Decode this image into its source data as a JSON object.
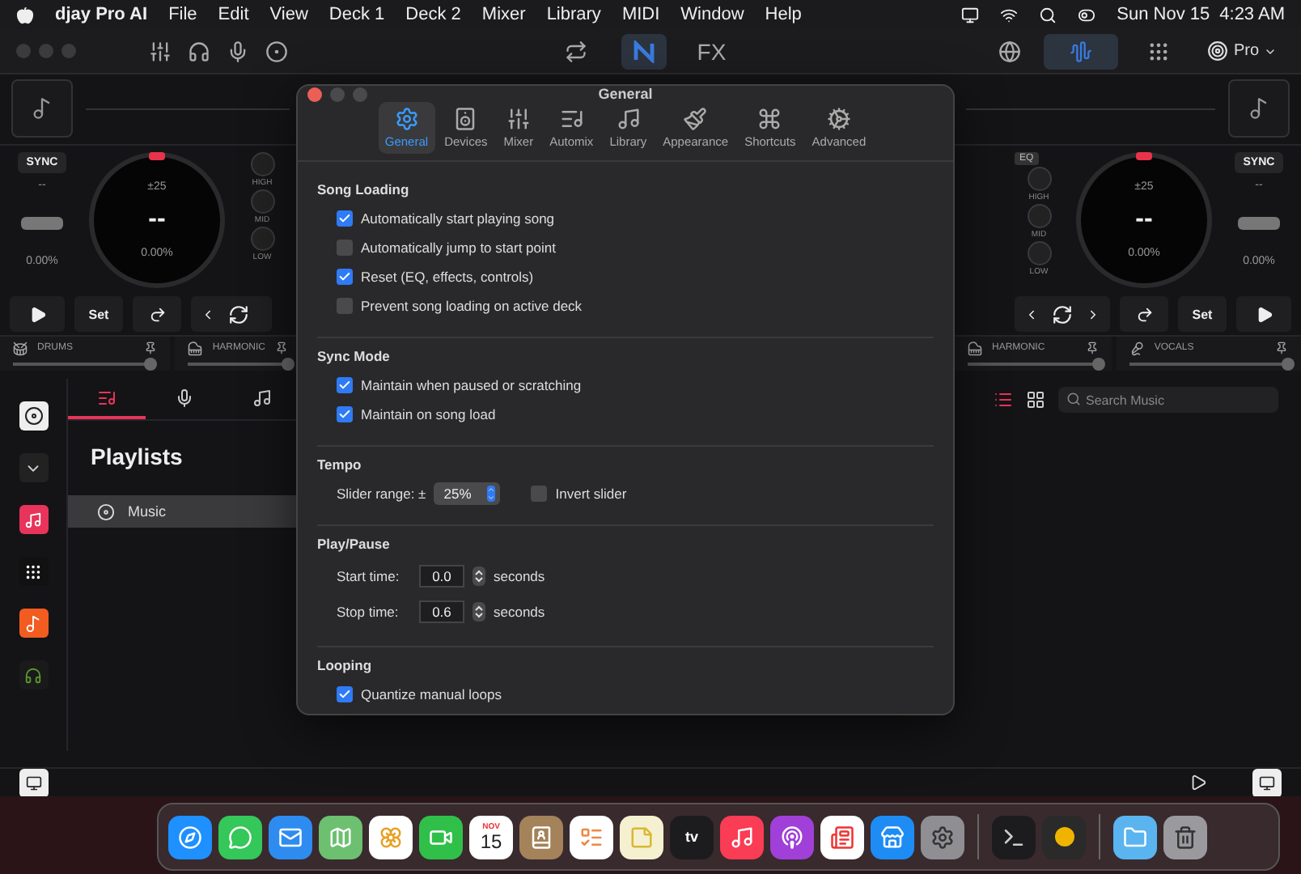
{
  "menu_bar": {
    "app_name": "djay Pro AI",
    "menus": [
      "File",
      "Edit",
      "View",
      "Deck 1",
      "Deck 2",
      "Mixer",
      "Library",
      "MIDI",
      "Window",
      "Help"
    ],
    "date": "Sun Nov 15",
    "time": "4:23 AM"
  },
  "toolbar": {
    "center": [
      {
        "kind": "loop",
        "selected": false
      },
      {
        "kind": "logo",
        "selected": true
      },
      {
        "kind": "fx",
        "label": "FX",
        "selected": false
      }
    ],
    "waveform_selected": true,
    "plan_label": "Pro"
  },
  "decks": [
    {
      "sync": "SYNC",
      "bpm": "--",
      "pitch": "0.00%",
      "range": "±25",
      "key": "--",
      "jog_pitch": "0.00%",
      "eq": [
        "HIGH",
        "MID",
        "LOW"
      ],
      "cue": "Set",
      "stems": [
        {
          "kind": "drums",
          "label": "DRUMS",
          "level": 0.95
        },
        {
          "kind": "harmonic",
          "label": "HARMONIC",
          "level": 1
        }
      ]
    },
    {
      "eq_label": "EQ",
      "sync": "SYNC",
      "bpm": "--",
      "pitch": "0.00%",
      "range": "±25",
      "key": "--",
      "jog_pitch": "0.00%",
      "eq": [
        "HIGH",
        "MID",
        "LOW"
      ],
      "cue": "Set",
      "stems": [
        {
          "kind": "harmonic",
          "label": "HARMONIC",
          "level": 1
        },
        {
          "kind": "vocals",
          "label": "VOCALS",
          "level": 1
        }
      ]
    }
  ],
  "library": {
    "tabs": [
      {
        "kind": "playlists",
        "selected": true
      },
      {
        "kind": "mic",
        "selected": false
      },
      {
        "kind": "music",
        "selected": false
      }
    ],
    "heading": "Playlists",
    "items": [
      {
        "label": "Music",
        "selected": true
      }
    ],
    "views": [
      {
        "kind": "list",
        "selected": true
      },
      {
        "kind": "grid",
        "selected": false
      }
    ],
    "search": {
      "placeholder": "Search Music"
    }
  },
  "dialog": {
    "title": "General",
    "tabs": [
      {
        "kind": "general",
        "label": "General",
        "selected": true
      },
      {
        "kind": "devices",
        "label": "Devices",
        "selected": false
      },
      {
        "kind": "mixer",
        "label": "Mixer",
        "selected": false
      },
      {
        "kind": "automix",
        "label": "Automix",
        "selected": false
      },
      {
        "kind": "library",
        "label": "Library",
        "selected": false
      },
      {
        "kind": "appearance",
        "label": "Appearance",
        "selected": false
      },
      {
        "kind": "shortcuts",
        "label": "Shortcuts",
        "selected": false
      },
      {
        "kind": "advanced",
        "label": "Advanced",
        "selected": false
      }
    ],
    "sections": [
      {
        "title": "Song Loading",
        "rows": [
          {
            "kind": "checkbox",
            "label": "Automatically start playing song",
            "checked": true
          },
          {
            "kind": "checkbox",
            "label": "Automatically jump to start point",
            "checked": false
          },
          {
            "kind": "checkbox",
            "label": "Reset (EQ, effects, controls)",
            "checked": true
          },
          {
            "kind": "checkbox",
            "label": "Prevent song loading on active deck",
            "checked": false
          }
        ]
      },
      {
        "title": "Sync Mode",
        "rows": [
          {
            "kind": "checkbox",
            "label": "Maintain when paused or scratching",
            "checked": true
          },
          {
            "kind": "checkbox",
            "label": "Maintain on song load",
            "checked": true
          }
        ]
      },
      {
        "title": "Tempo",
        "rows": [
          {
            "kind": "select",
            "label": "Slider range: ±",
            "value": "25%",
            "option": {
              "label": "Invert slider",
              "checked": false
            }
          }
        ]
      },
      {
        "title": "Play/Pause",
        "rows": [
          {
            "kind": "stepper",
            "label": "Start time:",
            "value": "0.0",
            "unit": "seconds"
          },
          {
            "kind": "stepper",
            "label": "Stop time:",
            "value": "0.6",
            "unit": "seconds"
          }
        ]
      },
      {
        "title": "Looping",
        "rows": [
          {
            "kind": "checkbox",
            "label": "Quantize manual loops",
            "checked": true
          }
        ]
      }
    ]
  },
  "dock": {
    "items": [
      {
        "kind": "compass",
        "color": "#1e90ff"
      },
      {
        "kind": "bubble",
        "color": "#34c759"
      },
      {
        "kind": "mail",
        "color": "#2e8cf0"
      },
      {
        "kind": "map",
        "color": "#6cc070"
      },
      {
        "kind": "flower",
        "color": "#ffffff"
      },
      {
        "kind": "camera",
        "color": "#30c04a"
      },
      {
        "kind": "calendar",
        "color": "#ffffff",
        "month": "NOV",
        "day": "15"
      },
      {
        "kind": "book",
        "color": "#a4825a"
      },
      {
        "kind": "list",
        "color": "#ffffff"
      },
      {
        "kind": "note",
        "color": "#f5f0d0"
      },
      {
        "kind": "tv",
        "color": "#1c1c1e",
        "label": "tv"
      },
      {
        "kind": "music",
        "color": "#fa3c55"
      },
      {
        "kind": "podcast",
        "color": "#a040d8"
      },
      {
        "kind": "news",
        "color": "#ffffff"
      },
      {
        "kind": "store",
        "color": "#1e8cf5"
      },
      {
        "kind": "gear",
        "color": "#8e8e93"
      },
      {
        "kind": "terminal",
        "color": "#1c1c1e"
      },
      {
        "kind": "dot",
        "color": "#2a2a2a"
      },
      {
        "kind": "folder",
        "color": "#5ab4f0"
      },
      {
        "kind": "trash",
        "color": "#9a9a9e"
      }
    ]
  }
}
